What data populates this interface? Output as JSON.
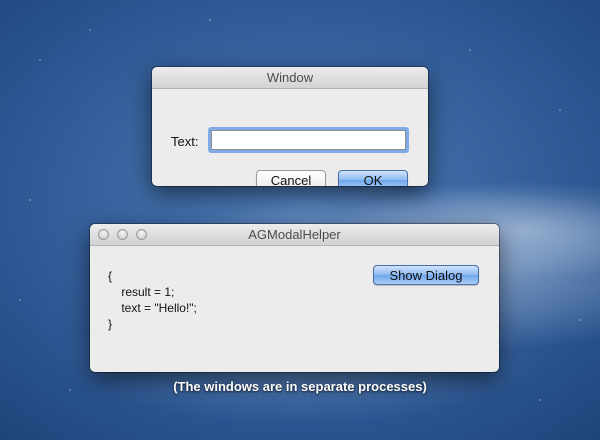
{
  "desktop": {
    "caption": "(The windows are in separate processes)"
  },
  "dialog_window": {
    "title": "Window",
    "text_label": "Text:",
    "text_value": "",
    "cancel_label": "Cancel",
    "ok_label": "OK"
  },
  "helper_window": {
    "title": "AGModalHelper",
    "code_text": "{\n    result = 1;\n    text = \"Hello!\";\n}",
    "show_dialog_label": "Show Dialog"
  },
  "colors": {
    "accent": "#6ea6ec",
    "focus_ring": "#5d96e6"
  }
}
